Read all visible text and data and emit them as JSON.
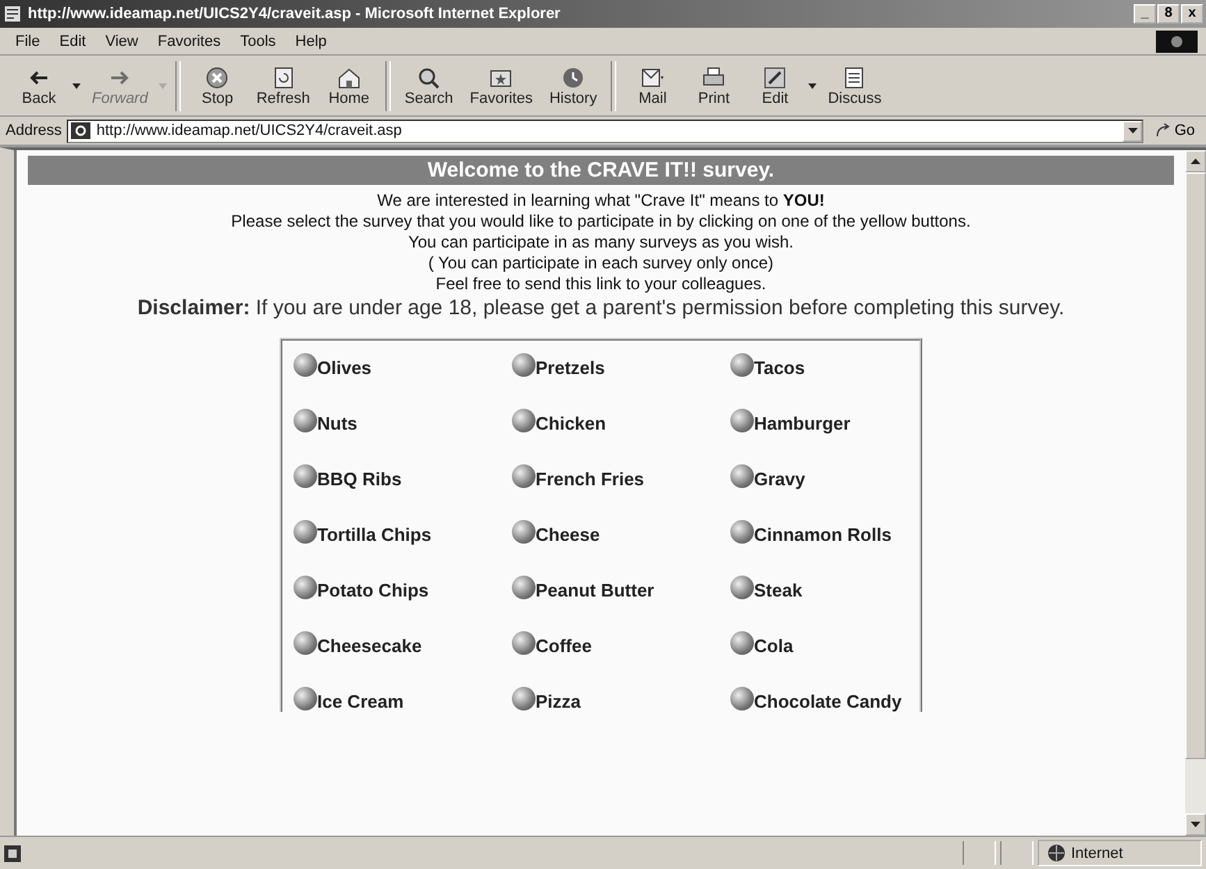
{
  "window": {
    "title": "http://www.ideamap.net/UICS2Y4/craveit.asp - Microsoft Internet Explorer",
    "controls": [
      "_",
      "8",
      "x"
    ]
  },
  "menu": [
    "File",
    "Edit",
    "View",
    "Favorites",
    "Tools",
    "Help"
  ],
  "toolbar": [
    {
      "label": "Back",
      "kind": "back",
      "disabled": false,
      "dropdown": true
    },
    {
      "label": "Forward",
      "kind": "forward",
      "disabled": true,
      "dropdown": true
    },
    {
      "label": "Stop",
      "kind": "stop",
      "disabled": false,
      "dropdown": false
    },
    {
      "label": "Refresh",
      "kind": "refresh",
      "disabled": false,
      "dropdown": false
    },
    {
      "label": "Home",
      "kind": "home",
      "disabled": false,
      "dropdown": false
    },
    {
      "label": "Search",
      "kind": "search",
      "disabled": false,
      "dropdown": false
    },
    {
      "label": "Favorites",
      "kind": "favorites",
      "disabled": false,
      "dropdown": false
    },
    {
      "label": "History",
      "kind": "history",
      "disabled": false,
      "dropdown": false
    },
    {
      "label": "Mail",
      "kind": "mail",
      "disabled": false,
      "dropdown": false
    },
    {
      "label": "Print",
      "kind": "print",
      "disabled": false,
      "dropdown": false
    },
    {
      "label": "Edit",
      "kind": "edit",
      "disabled": false,
      "dropdown": true
    },
    {
      "label": "Discuss",
      "kind": "discuss",
      "disabled": false,
      "dropdown": false
    }
  ],
  "address": {
    "label": "Address",
    "value": "http://www.ideamap.net/UICS2Y4/craveit.asp",
    "go": "Go"
  },
  "page": {
    "heading": "Welcome to the CRAVE IT!! survey.",
    "lines": [
      "We are interested in learning what \"Crave It\" means to **YOU!**",
      "Please select the survey that you would like to participate in by clicking on one of the yellow buttons.",
      "You can participate in as many surveys as you wish.",
      "( You can participate in each survey only once)",
      "Feel free to send this link to your colleagues."
    ],
    "disclaimer": "**Disclaimer:** If you are under age 18, please get a parent's permission before completing this survey.",
    "surveys": [
      [
        "Olives",
        "Pretzels",
        "Tacos"
      ],
      [
        "Nuts",
        "Chicken",
        "Hamburger"
      ],
      [
        "BBQ Ribs",
        "French Fries",
        "Gravy"
      ],
      [
        "Tortilla Chips",
        "Cheese",
        "Cinnamon Rolls"
      ],
      [
        "Potato Chips",
        "Peanut Butter",
        "Steak"
      ],
      [
        "Cheesecake",
        "Coffee",
        "Cola"
      ],
      [
        "Ice Cream",
        "Pizza",
        "Chocolate Candy"
      ]
    ]
  },
  "status_bar": {
    "zone": "Internet"
  }
}
